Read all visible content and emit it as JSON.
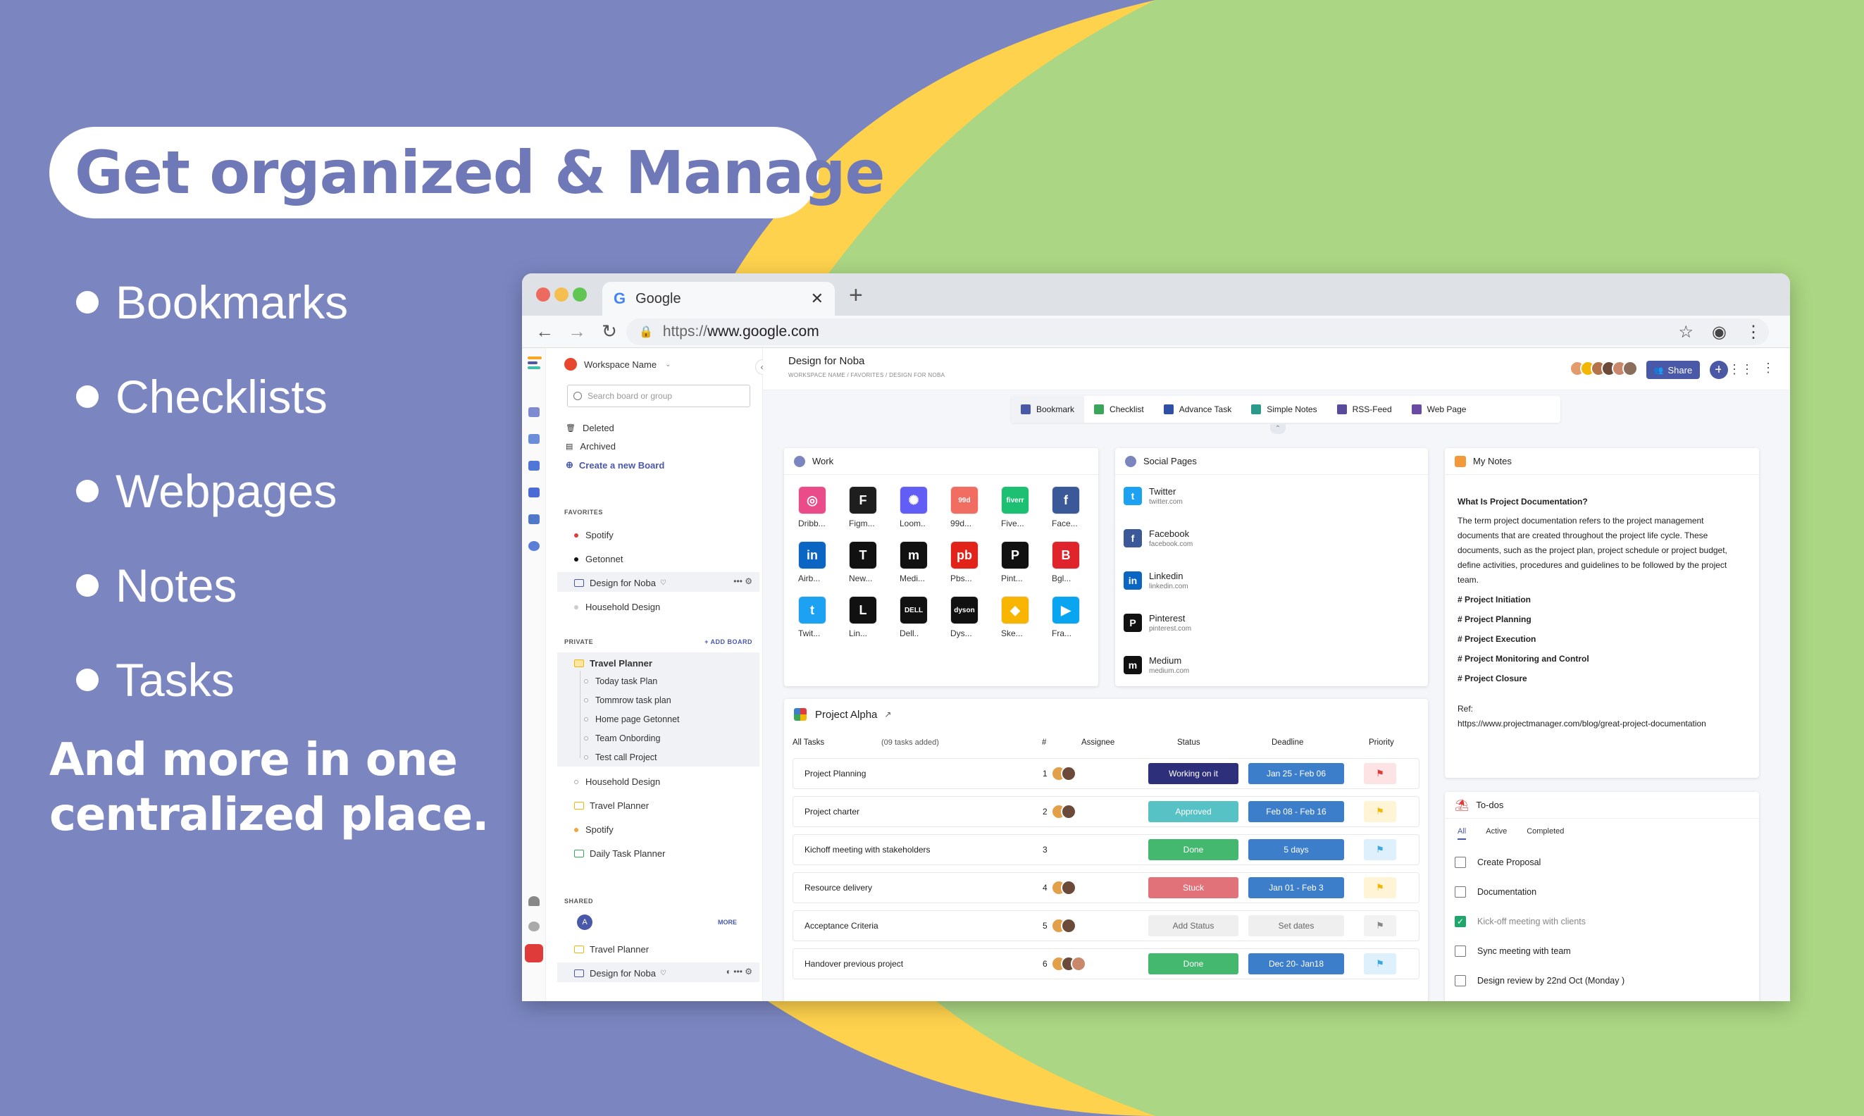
{
  "colors": {
    "purple": "#7b86c1",
    "yellow": "#fed24d",
    "green": "#abd683",
    "accent": "#4a58a8"
  },
  "promo": {
    "title": "Get organized & Manage",
    "bullets": [
      "Bookmarks",
      "Checklists",
      "Webpages",
      "Notes",
      "Tasks"
    ],
    "tagline_line1": "And more in one",
    "tagline_line2": "centralized place."
  },
  "browser": {
    "tab_title": "Google",
    "tab_icon": "G",
    "url_scheme": "https://",
    "url_host": "www.google.com"
  },
  "sidebar": {
    "workspace": "Workspace Name",
    "search_placeholder": "Search board or group",
    "deleted": "Deleted",
    "archived": "Archived",
    "create_board": "Create a new Board",
    "favorites_label": "FAVORITES",
    "favorites": [
      "Spotify",
      "Getonnet",
      "Design for Noba",
      "Household Design"
    ],
    "private_label": "PRIVATE",
    "add_board": "+ ADD BOARD",
    "travel_planner": "Travel Planner",
    "travel_children": [
      "Today task Plan",
      "Tommrow task plan",
      "Home page Getonnet",
      "Team Onbording",
      "Test call Project"
    ],
    "private_items": [
      "Household Design",
      "Travel Planner",
      "Spotify",
      "Daily Task Planner"
    ],
    "shared_label": "SHARED",
    "shared_avatar": "A",
    "more": "MORE",
    "shared_items": [
      "Travel Planner",
      "Design for Noba"
    ]
  },
  "header": {
    "title": "Design for Noba",
    "breadcrumb": "WORKSPACE NAME  /  FAVORITES  /  DESIGN FOR NOBA",
    "share": "Share"
  },
  "toolbar": [
    "Bookmark",
    "Checklist",
    "Advance Task",
    "Simple Notes",
    "RSS-Feed",
    "Web Page"
  ],
  "work": {
    "title": "Work",
    "items": [
      {
        "label": "Dribb...",
        "glyph": "◎",
        "color": "#ea4c89"
      },
      {
        "label": "Figm...",
        "glyph": "F",
        "color": "#1e1e1e"
      },
      {
        "label": "Loom..",
        "glyph": "✺",
        "color": "#625df5"
      },
      {
        "label": "99d...",
        "glyph": "99d",
        "color": "#f26d61"
      },
      {
        "label": "Five...",
        "glyph": "fiverr",
        "color": "#1dbf73"
      },
      {
        "label": "Face...",
        "glyph": "f",
        "color": "#3b5998"
      },
      {
        "label": "Airb...",
        "glyph": "in",
        "color": "#0a66c2"
      },
      {
        "label": "New...",
        "glyph": "T",
        "color": "#111111"
      },
      {
        "label": "Medi...",
        "glyph": "m",
        "color": "#111111"
      },
      {
        "label": "Pbs...",
        "glyph": "pb",
        "color": "#e2231a"
      },
      {
        "label": "Pint...",
        "glyph": "P",
        "color": "#111111"
      },
      {
        "label": "Bgl...",
        "glyph": "B",
        "color": "#e0242c"
      },
      {
        "label": "Twit...",
        "glyph": "t",
        "color": "#1da1f2"
      },
      {
        "label": "Lin...",
        "glyph": "L",
        "color": "#111111"
      },
      {
        "label": "Dell..",
        "glyph": "DELL",
        "color": "#111111"
      },
      {
        "label": "Dys...",
        "glyph": "dyson",
        "color": "#111111"
      },
      {
        "label": "Ske...",
        "glyph": "◆",
        "color": "#f7b500"
      },
      {
        "label": "Fra...",
        "glyph": "▶",
        "color": "#0aa5f0"
      }
    ]
  },
  "social": {
    "title": "Social Pages",
    "items": [
      {
        "name": "Twitter",
        "url": "twitter.com",
        "glyph": "t",
        "color": "#1da1f2"
      },
      {
        "name": "Facebook",
        "url": "facebook.com",
        "glyph": "f",
        "color": "#3b5998"
      },
      {
        "name": "Linkedin",
        "url": "linkedin.com",
        "glyph": "in",
        "color": "#0a66c2"
      },
      {
        "name": "Pinterest",
        "url": "pinterest.com",
        "glyph": "P",
        "color": "#111111"
      },
      {
        "name": "Medium",
        "url": "medium.com",
        "glyph": "m",
        "color": "#111111"
      }
    ]
  },
  "notes": {
    "title": "My Notes",
    "heading": "What Is Project Documentation?",
    "body": "The term project documentation refers to the project management documents that are created throughout the project life cycle. These documents, such as the project plan, project schedule or project budget, define activities, procedures and guidelines to be followed by the project team.",
    "tags": [
      "# Project Initiation",
      "# Project Planning",
      "# Project Execution",
      "# Project Monitoring and Control",
      "# Project Closure"
    ],
    "ref_label": "Ref:",
    "ref_url": "https://www.projectmanager.com/blog/great-project-documentation"
  },
  "project": {
    "title": "Project Alpha",
    "all_tasks": "All Tasks",
    "count": "(09 tasks added)",
    "cols": {
      "num": "#",
      "assignee": "Assignee",
      "status": "Status",
      "deadline": "Deadline",
      "priority": "Priority"
    },
    "rows": [
      {
        "name": "Project Planning",
        "num": "1",
        "status": "Working on it",
        "status_color": "#2e2f7a",
        "deadline": "Jan 25 - Feb 06",
        "deadline_color": "#3d7ecb",
        "flag_color": "#e03b3b",
        "flag_bg": "#fde3e3",
        "avatars": 2
      },
      {
        "name": "Project charter",
        "num": "2",
        "status": "Approved",
        "status_color": "#56c2c5",
        "deadline": "Feb 08 - Feb 16",
        "deadline_color": "#3d7ecb",
        "flag_color": "#f2b705",
        "flag_bg": "#fff5d6",
        "avatars": 2
      },
      {
        "name": "Kichoff meeting with stakeholders",
        "num": "3",
        "status": "Done",
        "status_color": "#45b86f",
        "deadline": "5 days",
        "deadline_color": "#3d7ecb",
        "flag_color": "#3aa7e0",
        "flag_bg": "#ddf0fb",
        "avatars": 0
      },
      {
        "name": "Resource delivery",
        "num": "4",
        "status": "Stuck",
        "status_color": "#e2727a",
        "deadline": "Jan 01 - Feb 3",
        "deadline_color": "#3d7ecb",
        "flag_color": "#f2b705",
        "flag_bg": "#fff5d6",
        "avatars": 2
      },
      {
        "name": "Acceptance Criteria",
        "num": "5",
        "status": "Add Status",
        "status_color": "#efefef",
        "deadline": "Set dates",
        "deadline_color": "#efefef",
        "flag_color": "#888888",
        "flag_bg": "#f2f2f2",
        "avatars": 2
      },
      {
        "name": "Handover previous project",
        "num": "6",
        "status": "Done",
        "status_color": "#45b86f",
        "deadline": "Dec 20- Jan18",
        "deadline_color": "#3d7ecb",
        "flag_color": "#3aa7e0",
        "flag_bg": "#ddf0fb",
        "avatars": 3
      }
    ]
  },
  "todos": {
    "title": "To-dos",
    "tabs": [
      "All",
      "Active",
      "Completed"
    ],
    "items": [
      {
        "text": "Create Proposal",
        "done": false
      },
      {
        "text": "Documentation",
        "done": false
      },
      {
        "text": "Kick-off meeting with clients",
        "done": true
      },
      {
        "text": "Sync meeting with team",
        "done": false
      },
      {
        "text": "Design review by 22nd Oct (Monday )",
        "done": false
      }
    ]
  }
}
